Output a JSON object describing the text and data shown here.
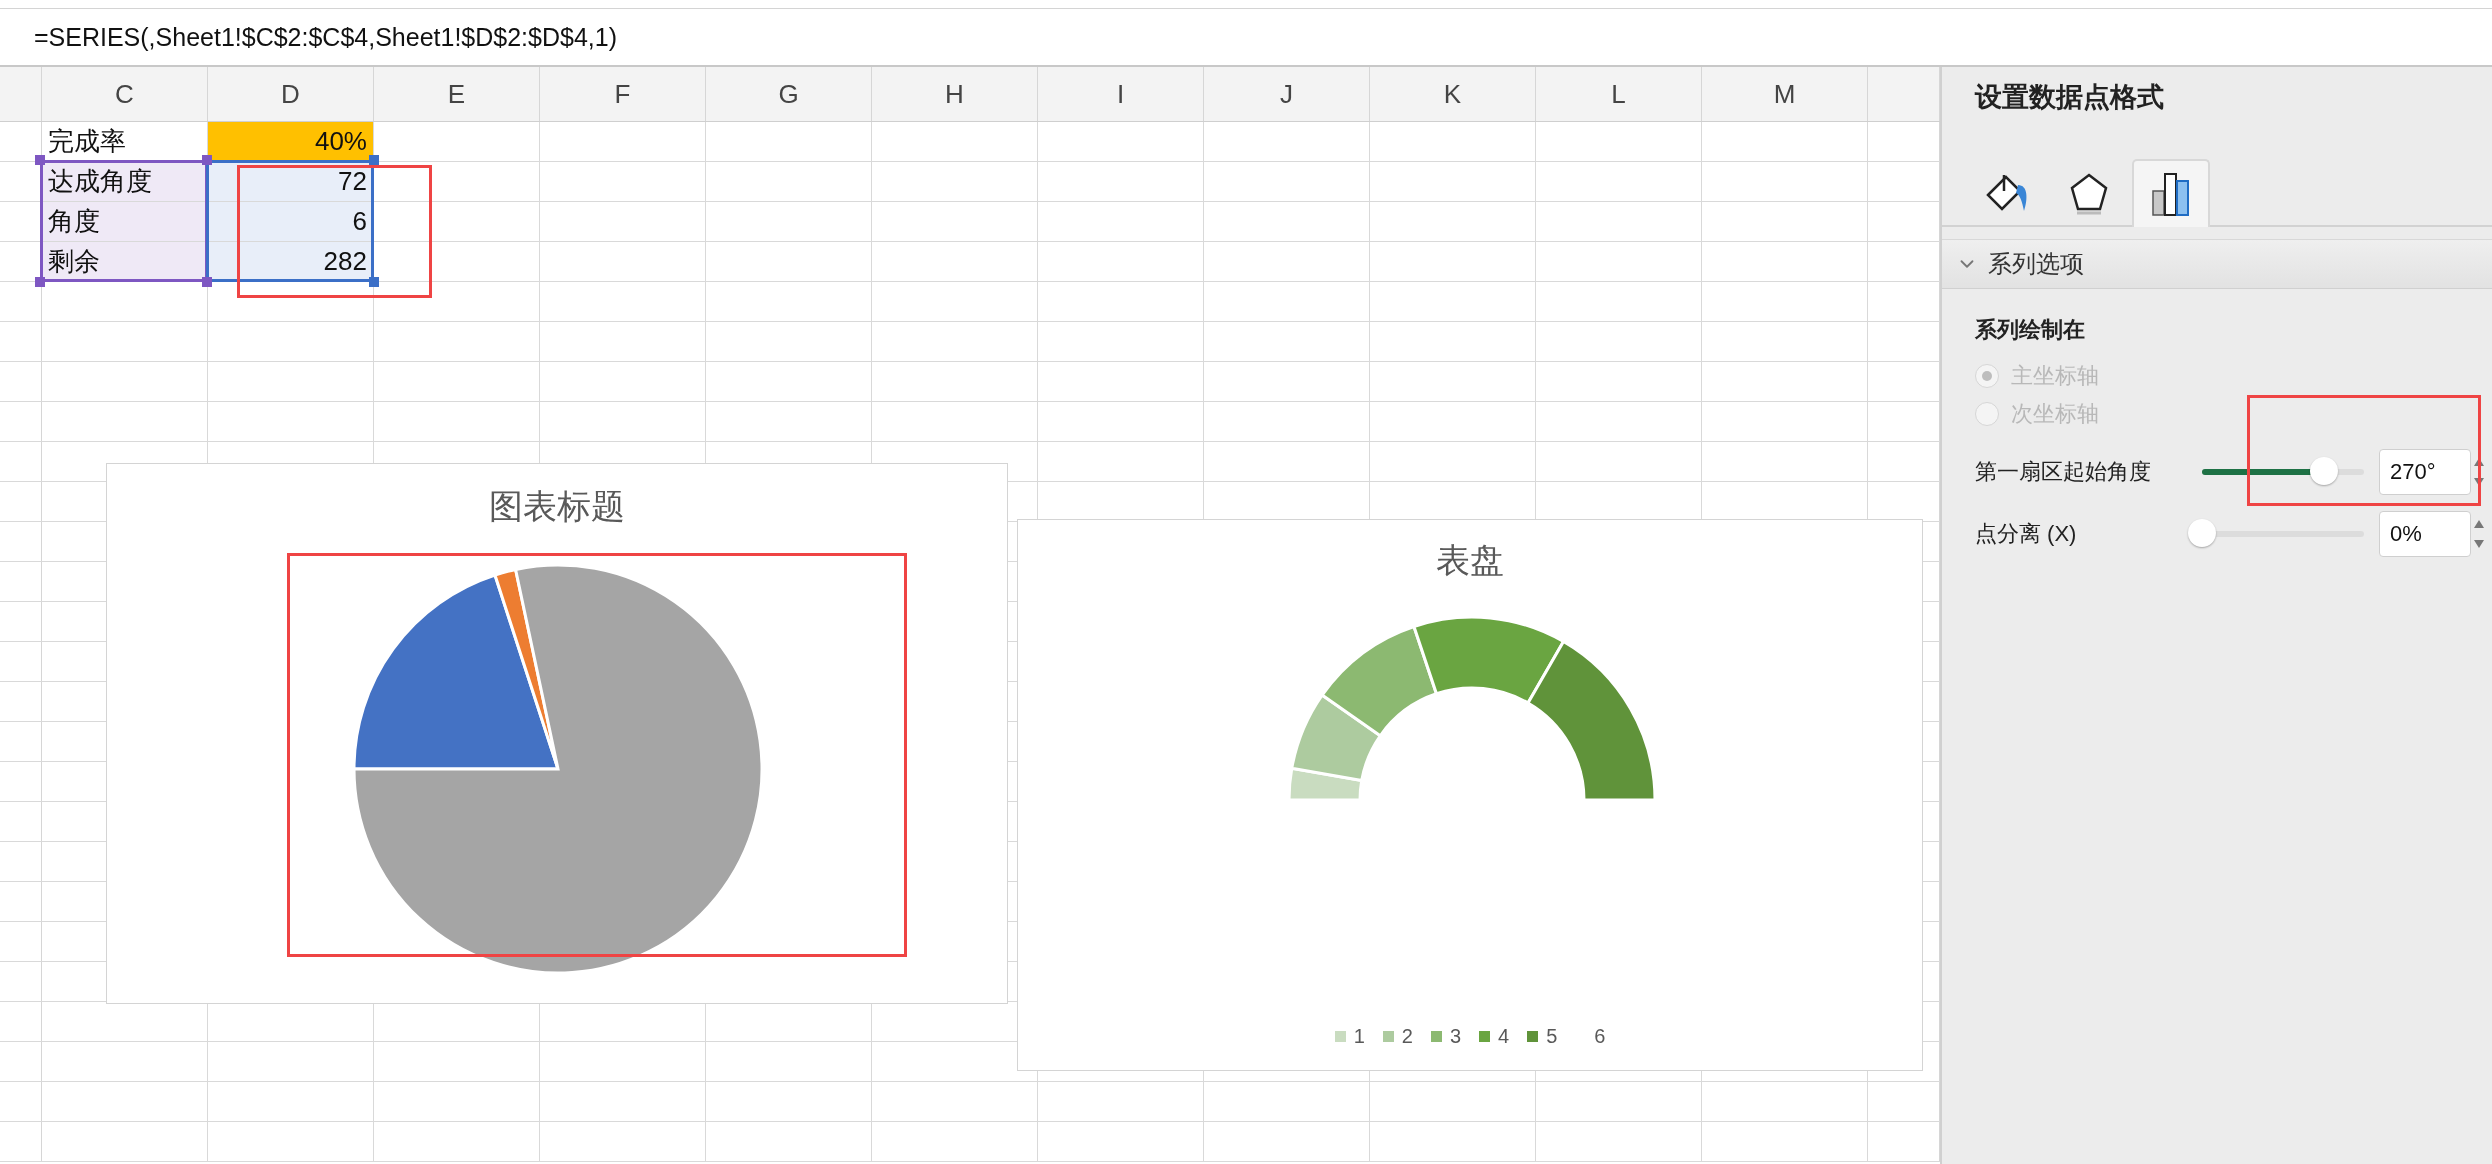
{
  "formula_bar": {
    "formula": "=SERIES(,Sheet1!$C$2:$C$4,Sheet1!$D$2:$D$4,1)"
  },
  "sheet": {
    "columns": [
      "C",
      "D",
      "E",
      "F",
      "G",
      "H",
      "I",
      "J",
      "K",
      "L",
      "M"
    ],
    "rows": [
      {
        "label": "完成率",
        "value": "40%",
        "selected": false,
        "color": "#ffc000"
      },
      {
        "label": "达成角度",
        "value": "72",
        "selected": true
      },
      {
        "label": "角度",
        "value": "6",
        "selected": true
      },
      {
        "label": "剩余",
        "value": "282",
        "selected": true
      }
    ]
  },
  "charts": [
    {
      "kind": "pie",
      "title": "图表标题"
    },
    {
      "kind": "gauge",
      "title": "表盘",
      "legend": [
        {
          "label": "1",
          "color": "#c9dcc0"
        },
        {
          "label": "2",
          "color": "#adcb9f"
        },
        {
          "label": "3",
          "color": "#8cb971"
        },
        {
          "label": "4",
          "color": "#6aa541"
        },
        {
          "label": "5",
          "color": "#60933a"
        },
        {
          "label": "6"
        }
      ]
    }
  ],
  "format_panel": {
    "title": "设置数据点格式",
    "tabs": [
      {
        "kind": "fill",
        "selected": false
      },
      {
        "kind": "effects",
        "selected": false
      },
      {
        "kind": "series",
        "selected": true
      }
    ],
    "section": {
      "title": "系列选项",
      "expanded": true
    },
    "plot_on": {
      "label": "系列绘制在",
      "options": [
        {
          "label": "主坐标轴",
          "selected": true,
          "disabled": true
        },
        {
          "label": "次坐标轴",
          "selected": false,
          "disabled": true
        }
      ]
    },
    "sliders": [
      {
        "label": "第一扇区起始角度",
        "level": 0.75,
        "value": "270°"
      },
      {
        "label": "点分离 (X)",
        "level": 0,
        "value": "0%"
      }
    ]
  }
}
